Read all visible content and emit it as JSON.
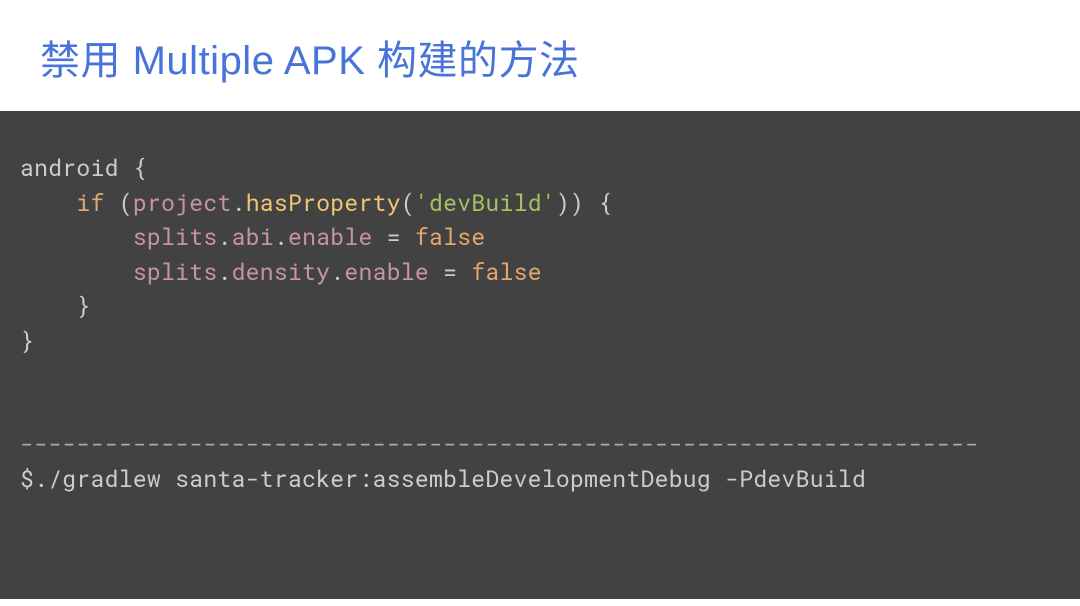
{
  "title": "禁用 Multiple APK 构建的方法",
  "code": {
    "line1_android": "android",
    "line1_brace": " {",
    "line2_indent": "    ",
    "line2_if": "if",
    "line2_sp": " (",
    "line2_project": "project",
    "line2_dot1": ".",
    "line2_hasProperty": "hasProperty",
    "line2_open": "(",
    "line2_str": "'devBuild'",
    "line2_close": ")) {",
    "line3_indent": "        ",
    "line3_splits": "splits",
    "line3_dot1": ".",
    "line3_abi": "abi",
    "line3_dot2": ".",
    "line3_enable": "enable",
    "line3_eq": " = ",
    "line3_false": "false",
    "line4_indent": "        ",
    "line4_splits": "splits",
    "line4_dot1": ".",
    "line4_density": "density",
    "line4_dot2": ".",
    "line4_enable": "enable",
    "line4_eq": " = ",
    "line4_false": "false",
    "line5": "    }",
    "line6": "}",
    "divider": "--------------------------------------------------------------------",
    "command": "$./gradlew santa-tracker:assembleDevelopmentDebug -PdevBuild"
  }
}
